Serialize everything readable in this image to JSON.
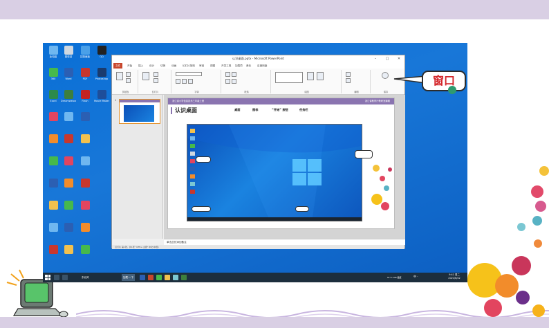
{
  "callout": {
    "text": "窗口"
  },
  "desktop": {
    "icons": [
      {
        "label": "此电脑",
        "color": "#6fb7f0"
      },
      {
        "label": "回收站",
        "color": "#d0d8e0"
      },
      {
        "label": "控制面板",
        "color": "#4aa0e8"
      },
      {
        "label": "QQ",
        "color": "#222222"
      },
      {
        "label": "360",
        "color": "#46b94b"
      },
      {
        "label": "Word",
        "color": "#2b5fb3"
      },
      {
        "label": "PDF",
        "color": "#c8372d"
      },
      {
        "label": "Photoshop",
        "color": "#1a3b6e"
      },
      {
        "label": "Excel",
        "color": "#2c8a4b"
      },
      {
        "label": "Dreamweaver",
        "color": "#3d7f3e"
      },
      {
        "label": "Flash",
        "color": "#c42222"
      },
      {
        "label": "Movie Maker",
        "color": "#1e4e9a"
      }
    ]
  },
  "taskbar": {
    "items": [
      "东北风",
      "加载·一下"
    ],
    "tray": "中 ·",
    "clock_time": "9:41 周二",
    "clock_date": "2021/6/22",
    "status_text": "51°C CPU温度"
  },
  "ppt": {
    "title": "认识桌面.pptx - Microsoft PowerPoint",
    "tabs": [
      "文件",
      "开始",
      "插入",
      "设计",
      "切换",
      "动画",
      "幻灯片放映",
      "审阅",
      "视图",
      "开发工具",
      "加载项",
      "美化",
      "百度网盘"
    ],
    "groups": [
      "剪贴板",
      "幻灯片",
      "字体",
      "段落",
      "绘图",
      "编辑",
      "保存"
    ],
    "notes_placeholder": "单击此处添加备注",
    "status_text": "幻灯片 第1张，共1张    \"Office 主题\"    中文(中国)"
  },
  "slide": {
    "header_left": "浙江省小学信息技术三年级上册",
    "header_right": "浙江省教育厅教研室编著",
    "title": "认识桌面",
    "nav": [
      "桌面",
      "图标",
      "“开始” 按钮",
      "任务栏"
    ]
  }
}
